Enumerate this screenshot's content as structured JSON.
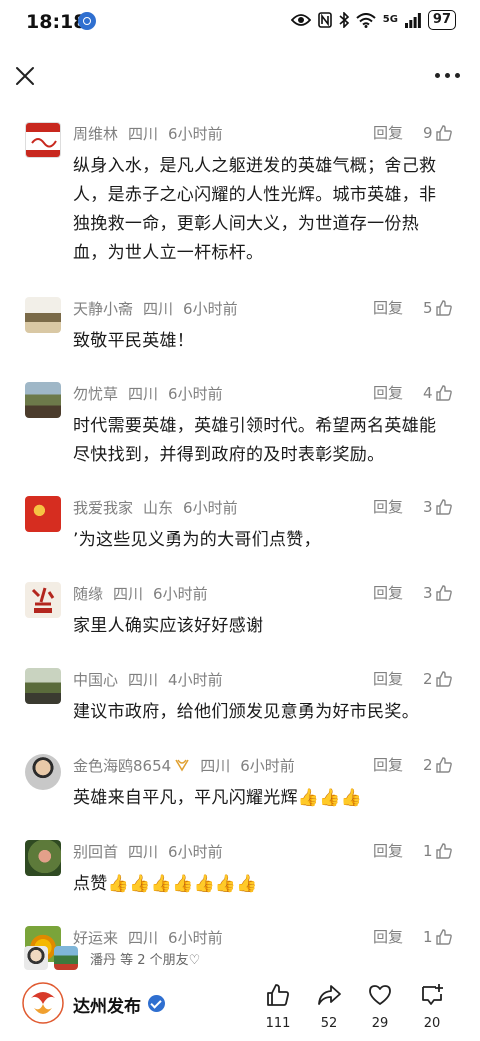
{
  "status_bar": {
    "time": "18:18",
    "battery": "97",
    "network": "5G"
  },
  "topbar": {
    "close": "close-icon",
    "more": "more-icon"
  },
  "comments": [
    {
      "name": "周维林",
      "region": "四川",
      "time": "6小时前",
      "reply": "回复",
      "likes": "9",
      "content": "纵身入水，是凡人之躯迸发的英雄气概；舍己救人，是赤子之心闪耀的人性光辉。城市英雄，非独挽救一命，更彰人间大义，为世道存一份热血，为世人立一杆标杆。"
    },
    {
      "name": "天静小斋",
      "region": "四川",
      "time": "6小时前",
      "reply": "回复",
      "likes": "5",
      "content": "致敬平民英雄！"
    },
    {
      "name": "勿忧草",
      "region": "四川",
      "time": "6小时前",
      "reply": "回复",
      "likes": "4",
      "content": "时代需要英雄，英雄引领时代。希望两名英雄能尽快找到，并得到政府的及时表彰奖励。"
    },
    {
      "name": "我爱我家",
      "region": "山东",
      "time": "6小时前",
      "reply": "回复",
      "likes": "3",
      "content": "’为这些见义勇为的大哥们点赞，"
    },
    {
      "name": "随缘",
      "region": "四川",
      "time": "6小时前",
      "reply": "回复",
      "likes": "3",
      "content": "家里人确实应该好好感谢"
    },
    {
      "name": "中国心",
      "region": "四川",
      "time": "4小时前",
      "reply": "回复",
      "likes": "2",
      "content": "建议市政府，给他们颁发见意勇为好市民奖。"
    },
    {
      "name": "金色海鸥8654",
      "region": "四川",
      "time": "6小时前",
      "reply": "回复",
      "likes": "2",
      "content": "英雄来自平凡，平凡闪耀光辉👍👍👍"
    },
    {
      "name": "别回首",
      "region": "四川",
      "time": "6小时前",
      "reply": "回复",
      "likes": "1",
      "content": "点赞👍👍👍👍👍👍👍"
    },
    {
      "name": "好运来",
      "region": "四川",
      "time": "6小时前",
      "reply": "回复",
      "likes": "1",
      "content": ""
    }
  ],
  "friends_liked": "潘丹 等 2 个朋友♡",
  "bottom": {
    "brand": "达州发布",
    "like_count": "111",
    "share_count": "52",
    "favorite_count": "29",
    "comment_count": "20"
  }
}
